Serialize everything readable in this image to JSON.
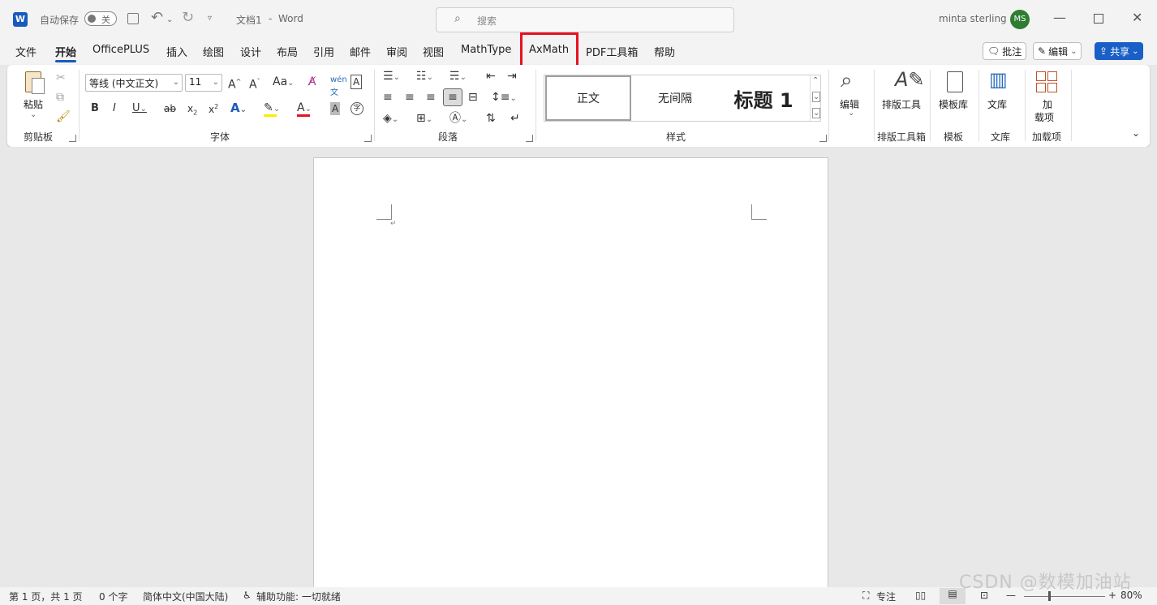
{
  "titlebar": {
    "autosave_label": "自动保存",
    "autosave_state": "关",
    "doc_title": "文档1",
    "separator": "-",
    "app_name": "Word",
    "search_placeholder": "搜索",
    "user_name": "minta sterling",
    "avatar_initials": "MS"
  },
  "tabs": [
    "文件",
    "开始",
    "OfficePLUS",
    "插入",
    "绘图",
    "设计",
    "布局",
    "引用",
    "邮件",
    "审阅",
    "视图",
    "MathType",
    "AxMath",
    "PDF工具箱",
    "帮助"
  ],
  "active_tab": "开始",
  "highlighted_tab": "AxMath",
  "right_buttons": {
    "comments": "批注",
    "editing": "编辑",
    "share": "共享"
  },
  "ribbon": {
    "clipboard": {
      "paste": "粘贴",
      "label": "剪贴板"
    },
    "font": {
      "font_name": "等线 (中文正文)",
      "font_size": "11",
      "label": "字体"
    },
    "paragraph": {
      "label": "段落"
    },
    "styles": {
      "items": [
        "正文",
        "无间隔",
        "标题 1"
      ],
      "label": "样式"
    },
    "editing": {
      "button": "编辑"
    },
    "layout_tools": {
      "button": "排版工具",
      "label": "排版工具箱"
    },
    "template": {
      "button": "模板库",
      "label": "模板"
    },
    "library": {
      "button": "文库",
      "label": "文库"
    },
    "addins": {
      "button_line1": "加",
      "button_line2": "载项",
      "label": "加载项"
    }
  },
  "status": {
    "page": "第 1 页，共 1 页",
    "words": "0 个字",
    "language": "简体中文(中国大陆)",
    "accessibility": "辅助功能: 一切就绪",
    "focus": "专注",
    "zoom": "80%"
  },
  "watermark": "CSDN @数模加油站",
  "colors": {
    "accent": "#185abd",
    "highlight": "#e81123",
    "avatar": "#2e7d32",
    "share": "#1a5fc7"
  }
}
